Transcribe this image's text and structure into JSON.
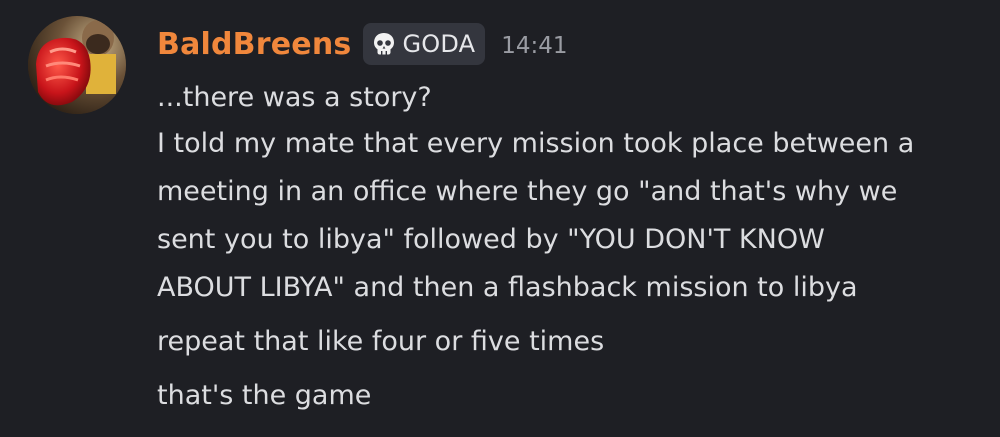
{
  "message": {
    "author": {
      "name": "BaldBreens",
      "name_color": "#f0873c",
      "avatar_icon": "avatar-red-fist"
    },
    "tag": {
      "icon": "skull-icon",
      "label": "GODA"
    },
    "timestamp": "14:41",
    "lines": [
      "...there was a story?",
      "I told my mate that every mission took place between a",
      "meeting in an office where they go \"and that's why we",
      "sent you to libya\" followed by \"YOU DON'T KNOW",
      "ABOUT LIBYA\" and then a flashback mission to libya",
      "repeat that like four or five times",
      "that's the game"
    ]
  }
}
